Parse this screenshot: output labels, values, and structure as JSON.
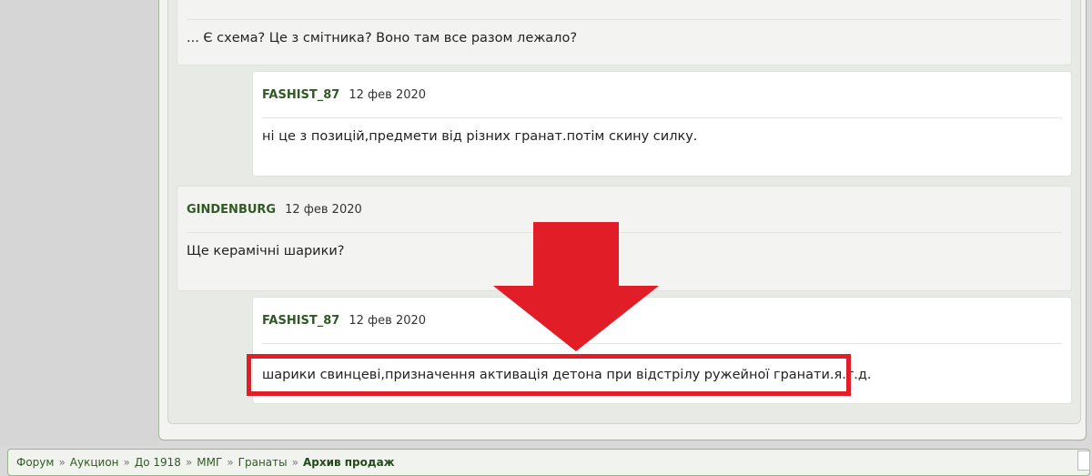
{
  "posts": [
    {
      "author": "",
      "date": "",
      "text": "... Є схема? Це з смітника? Воно там все разом лежало?"
    },
    {
      "author": "FASHIST_87",
      "date": "12 фев 2020",
      "text": "ні це з позицій,предмети від різних гранат.потім скину силку."
    },
    {
      "author": "GINDENBURG",
      "date": "12 фев 2020",
      "text": "Ще керамічні шарики?"
    },
    {
      "author": "FASHIST_87",
      "date": "12 фев 2020",
      "text": "шарики свинцеві,призначення активація детона при відстрілу ружейної гранати.я.т.д."
    }
  ],
  "annotation": {
    "arrow_color": "#e11d27",
    "box_color": "#e11d27"
  },
  "breadcrumb": {
    "separator": "»",
    "items": [
      "Форум",
      "Аукцион",
      "До 1918",
      "ММГ",
      "Гранаты",
      "Архив продаж"
    ]
  }
}
